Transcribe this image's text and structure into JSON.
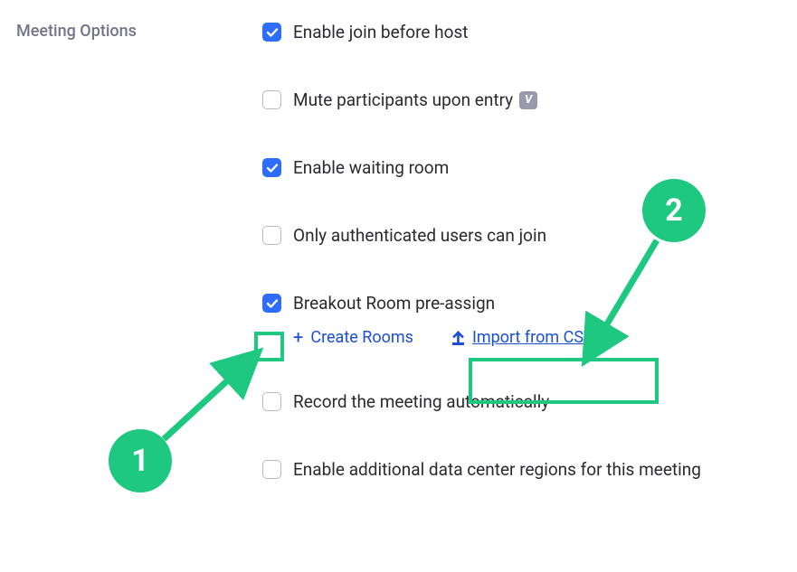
{
  "section": {
    "label": "Meeting Options"
  },
  "options": {
    "enable_join_before_host": {
      "label": "Enable join before host",
      "checked": true
    },
    "mute_participants": {
      "label": "Mute participants upon entry",
      "checked": false,
      "badge": "V"
    },
    "enable_waiting_room": {
      "label": "Enable waiting room",
      "checked": true
    },
    "only_authenticated": {
      "label": "Only authenticated users can join",
      "checked": false
    },
    "breakout_preassign": {
      "label": "Breakout Room pre-assign",
      "checked": true
    },
    "record_automatically": {
      "label": "Record the meeting automatically",
      "checked": false
    },
    "additional_dc_regions": {
      "label": "Enable additional data center regions for this meeting",
      "checked": false
    }
  },
  "breakout_actions": {
    "create_rooms": {
      "label": "Create Rooms"
    },
    "import_csv": {
      "label": "Import from CSV"
    }
  },
  "annotations": {
    "badge1": "1",
    "badge2": "2"
  }
}
